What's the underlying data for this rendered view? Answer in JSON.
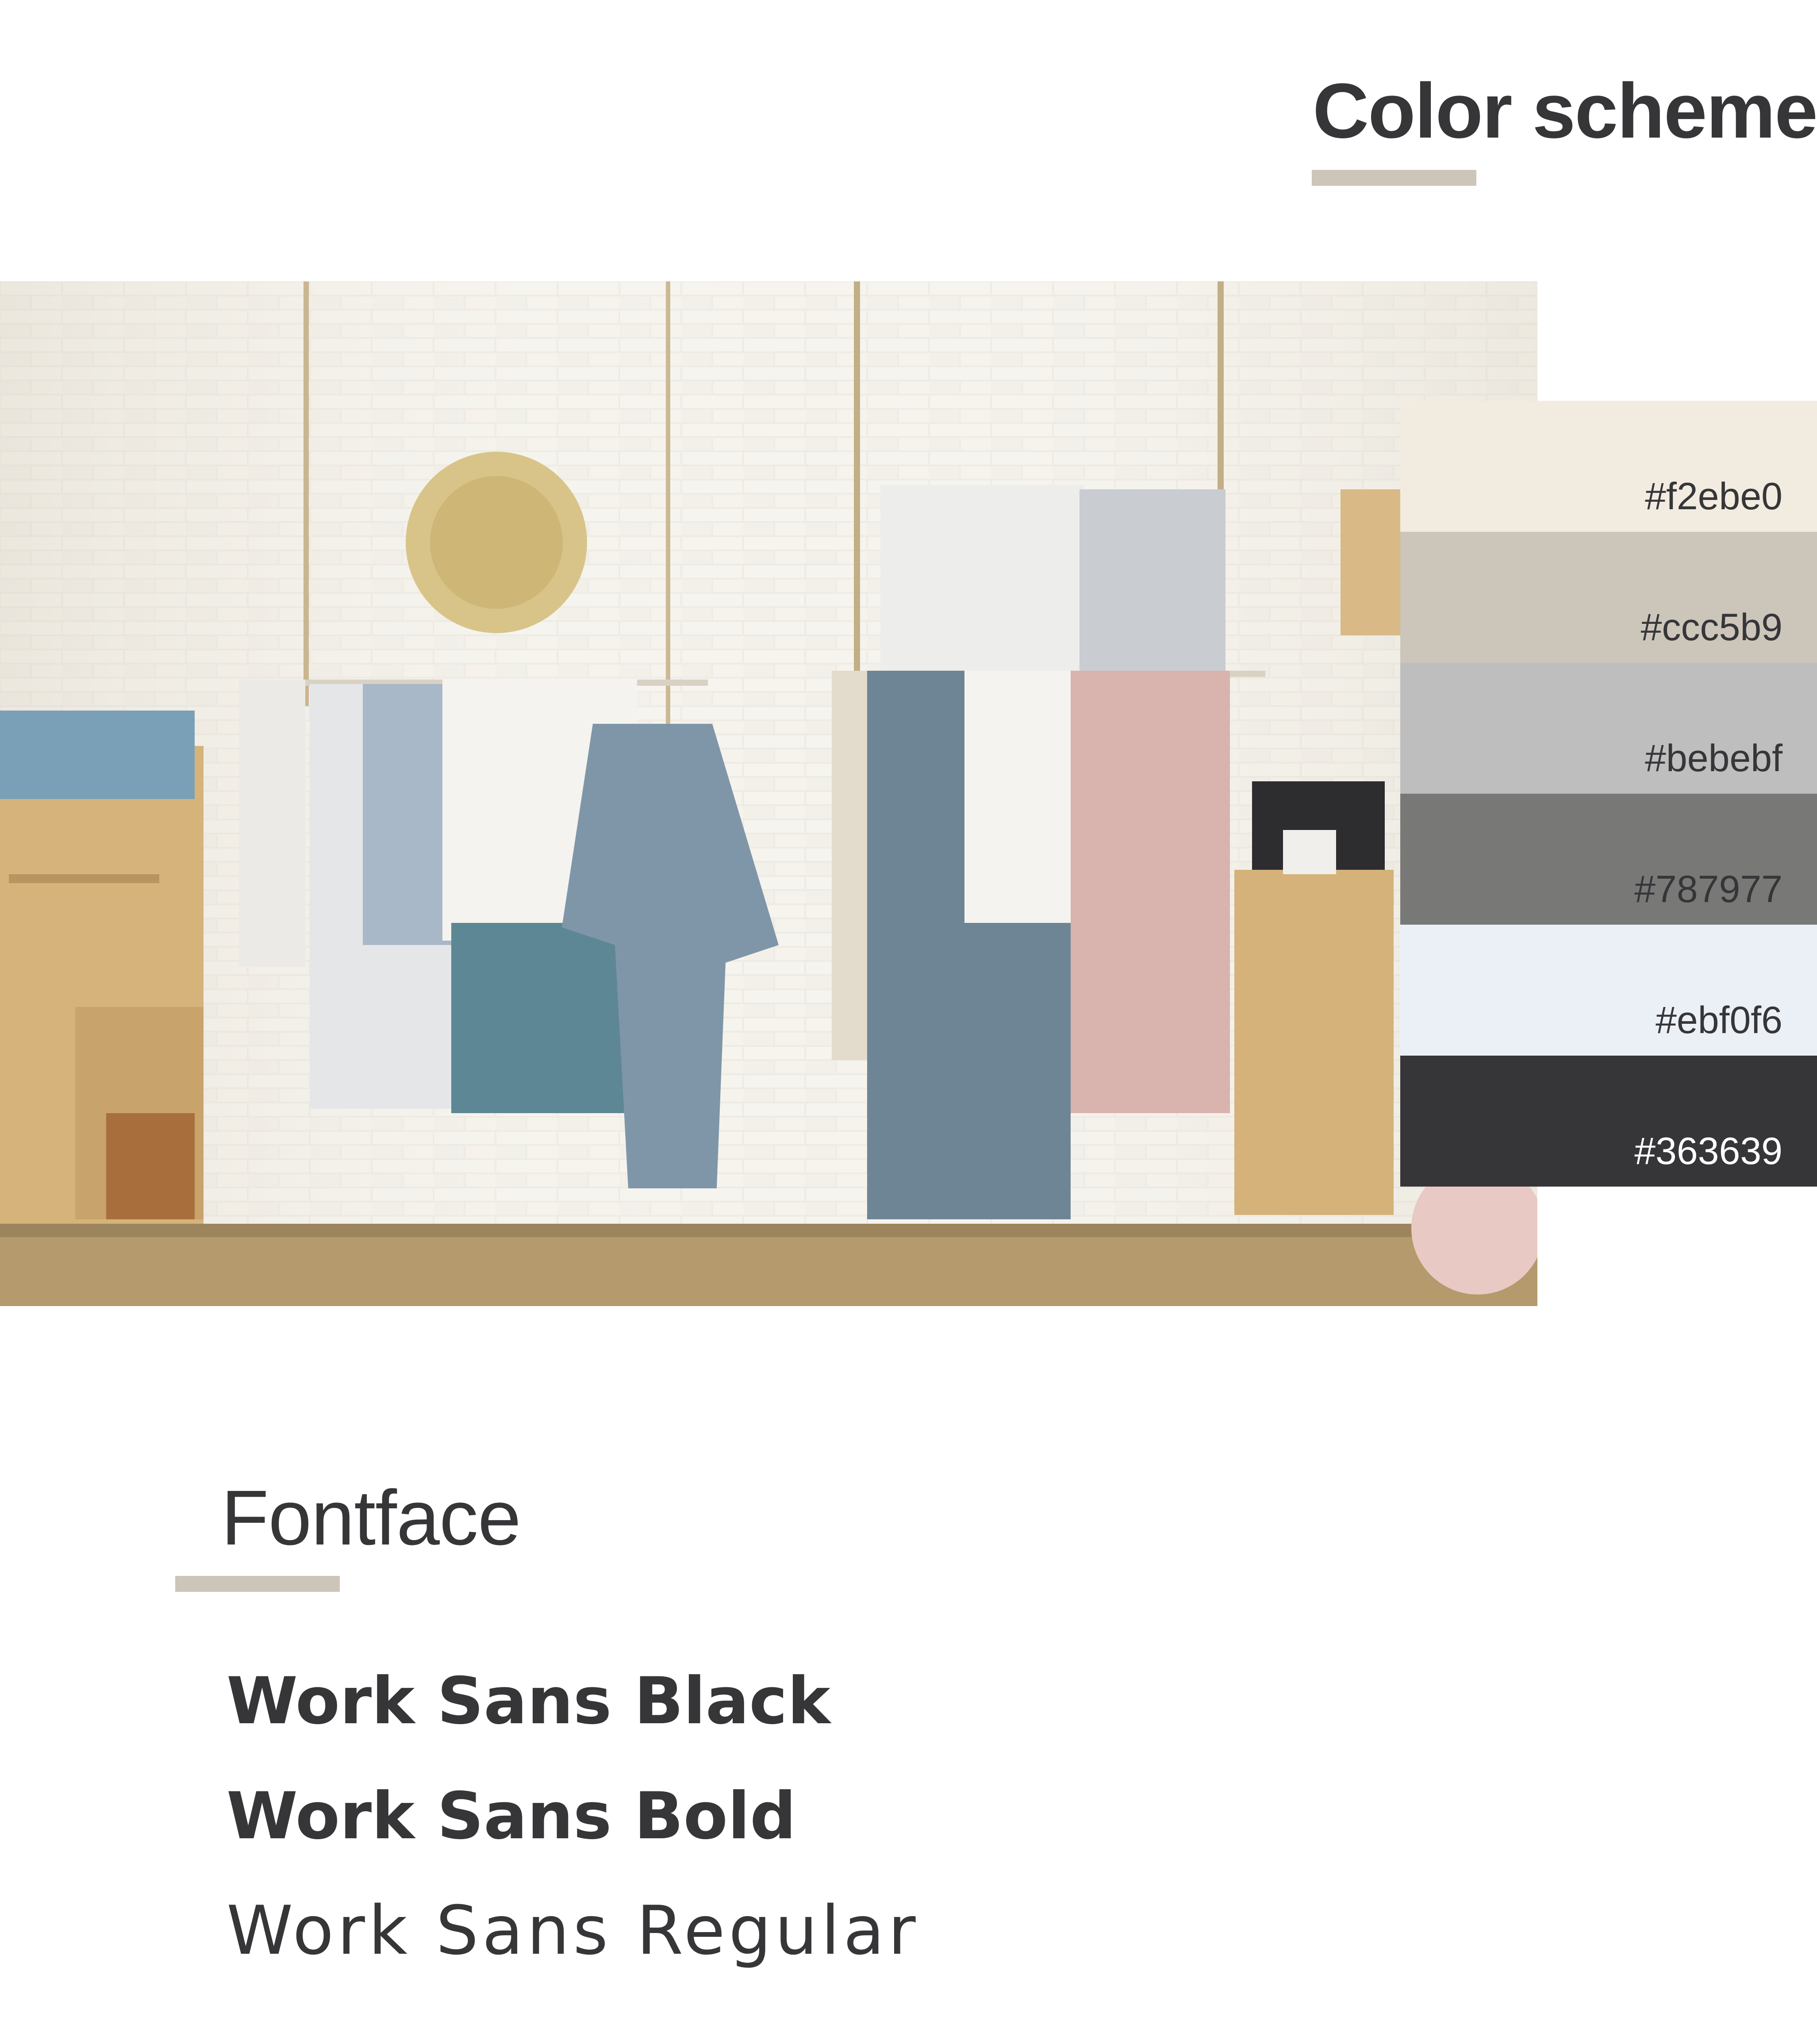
{
  "color_scheme": {
    "title": "Color scheme",
    "underline_color": "#ccc5b9",
    "swatches": [
      {
        "hex": "#f2ebe0",
        "label": "#f2ebe0",
        "text_color": "#363639"
      },
      {
        "hex": "#ccc5b9",
        "label": "#ccc5b9",
        "text_color": "#363639"
      },
      {
        "hex": "#bebebf",
        "label": "#bebebf",
        "text_color": "#363639"
      },
      {
        "hex": "#787977",
        "label": "#787977",
        "text_color": "#363639"
      },
      {
        "hex": "#ebf0f6",
        "label": "#ebf0f6",
        "text_color": "#363639"
      },
      {
        "hex": "#363639",
        "label": "#363639",
        "text_color": "#ffffff"
      }
    ]
  },
  "photo": {
    "subject": "textile shop interior with towels and robe hanging on white brick wall"
  },
  "fontface": {
    "title": "Fontface",
    "underline_color": "#ccc5b9",
    "samples": {
      "black": "Work Sans Black",
      "bold": "Work Sans Bold",
      "regular": "Work Sans Regular"
    }
  },
  "text_color": "#363639"
}
